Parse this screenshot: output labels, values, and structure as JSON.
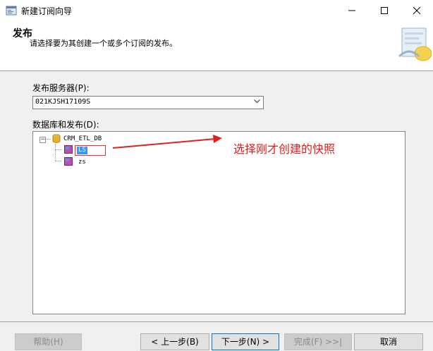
{
  "window": {
    "title": "新建订阅向导",
    "minimize_glyph": "—",
    "maximize_glyph": "☐",
    "close_glyph": "✕"
  },
  "header": {
    "title": "发布",
    "subtitle": "请选择要为其创建一个或多个订阅的发布。"
  },
  "publisher": {
    "label": "发布服务器(P):",
    "selected_value": "021KJSH17109S"
  },
  "publications": {
    "label": "数据库和发布(D):",
    "tree": {
      "root": "CRM_ETL_DB",
      "expander": "−",
      "children": [
        "LS",
        "zs"
      ]
    }
  },
  "annotation": {
    "text": "选择刚才创建的快照",
    "color": "#e02020"
  },
  "footer": {
    "help": "帮助(H)",
    "back": "< 上一步(B)",
    "next": "下一步(N) >",
    "finish": "完成(F) >>|",
    "cancel": "取消"
  },
  "colors": {
    "selection": "#3399ff",
    "focus_border": "#0078d7"
  },
  "icons": [
    "app-icon",
    "minimize-icon",
    "maximize-icon",
    "close-icon",
    "wizard-graphic-icon",
    "dropdown-arrow-icon",
    "database-icon",
    "publication-icon"
  ]
}
